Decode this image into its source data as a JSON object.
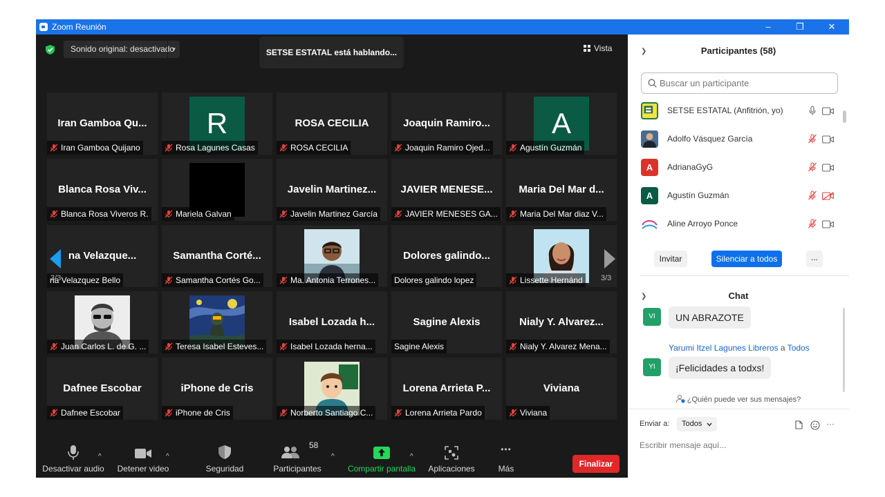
{
  "window": {
    "title": "Zoom Reunión",
    "minimize": "–",
    "restore": "❐",
    "close": "✕"
  },
  "top": {
    "sound_label": "Sonido original: desactivado",
    "sound_caret": "▼",
    "speaking": "SETSE ESTATAL está hablando...",
    "view_label": "Vista"
  },
  "pages": {
    "left": "3/3",
    "right": "3/3"
  },
  "tiles": [
    {
      "title": "Iran Gamboa Qu...",
      "label": "Iran Gamboa Quijano",
      "muted": true
    },
    {
      "initial": "R",
      "avatar_color": "#0b5a44",
      "label": "Rosa Lagunes Casas",
      "muted": true
    },
    {
      "title": "ROSA CECILIA",
      "label": "ROSA CECILIA",
      "muted": true
    },
    {
      "title": "Joaquin Ramiro...",
      "label": "Joaquin Ramiro Ojed...",
      "muted": true
    },
    {
      "initial": "A",
      "avatar_color": "#0b5a44",
      "label": "Agustín Guzmán",
      "muted": true
    },
    {
      "title": "Blanca Rosa Viv...",
      "label": "Blanca Rosa Viveros R.",
      "muted": true
    },
    {
      "photo": "black",
      "label": "Mariela Galvan",
      "muted": true
    },
    {
      "title": "Javelin Martinez...",
      "label": "Javelin Martinez García",
      "muted": true
    },
    {
      "title": "JAVIER MENESE...",
      "label": "JAVIER MENESES GA...",
      "muted": true
    },
    {
      "title": "Maria Del Mar d...",
      "label": "Maria Del Mar diaz V...",
      "muted": true
    },
    {
      "title": "na Velazque...",
      "label": "na Velazquez Bello",
      "muted": false
    },
    {
      "title": "Samantha Corté...",
      "label": "Samantha Cortés Go...",
      "muted": true
    },
    {
      "photo": "person-glasses",
      "label": "Ma. Antonia Terrones...",
      "muted": true
    },
    {
      "title": "Dolores galindo...",
      "label": "Dolores galindo lopez",
      "muted": false
    },
    {
      "photo": "woman",
      "label": "Lissette Hernánd",
      "muted": true
    },
    {
      "photo": "man-sunglasses",
      "label": "Juan Carlos L. de G. ...",
      "muted": true
    },
    {
      "photo": "starry-night",
      "label": "Teresa Isabel Esteves...",
      "muted": true
    },
    {
      "title": "Isabel Lozada h...",
      "label": "Isabel Lozada herna...",
      "muted": true
    },
    {
      "title": "Sagine Alexis",
      "label": "Sagine Alexis",
      "muted": false
    },
    {
      "title": "Nialy Y. Alvarez...",
      "label": "Nialy Y. Alvarez Mena...",
      "muted": true
    },
    {
      "title": "Dafnee Escobar",
      "label": "Dafnee Escobar",
      "muted": true
    },
    {
      "title": "iPhone de Cris",
      "label": "iPhone de Cris",
      "muted": true
    },
    {
      "photo": "cartoon",
      "label": "Norberto Santiago C...",
      "muted": true
    },
    {
      "title": "Lorena Arrieta P...",
      "label": "Lorena Arrieta Pardo",
      "muted": true
    },
    {
      "title": "Viviana",
      "label": "Viviana",
      "muted": true
    }
  ],
  "toolbar": {
    "audio": "Desactivar audio",
    "video": "Detener video",
    "security": "Seguridad",
    "participants": "Participantes",
    "participants_count": "58",
    "share": "Compartir pantalla",
    "apps": "Aplicaciones",
    "more": "Más",
    "end": "Finalizar",
    "caret": "^",
    "more_dots": "•••"
  },
  "participants_panel": {
    "title": "Participantes (58)",
    "search_placeholder": "Buscar un participante",
    "items": [
      {
        "name": "SETSE ESTATAL (Anfitrión, yo)",
        "avatar": "logo",
        "mic": "on",
        "cam": "on"
      },
      {
        "name": "Adolfo Vásquez García",
        "avatar": "photo",
        "mic": "off",
        "cam": "on"
      },
      {
        "name": "AdrianaGyG",
        "avatar": "A",
        "avatar_color": "#d9342b",
        "mic": "off",
        "cam": "on"
      },
      {
        "name": "Agustín Guzmán",
        "avatar": "A",
        "avatar_color": "#0b5a44",
        "mic": "off",
        "cam": "off"
      },
      {
        "name": "Aline Arroyo Ponce",
        "avatar": "logo2",
        "mic": "off",
        "cam": "on"
      }
    ],
    "invite": "Invitar",
    "mute_all": "Silenciar a todos",
    "more": "..."
  },
  "chat": {
    "title": "Chat",
    "messages": [
      {
        "initials": "VI",
        "text": "UN ABRAZOTE"
      },
      {
        "initials": "YI",
        "sender": "Yarumi Itzel Lagunes Libreros",
        "to_word": "a",
        "to": "Todos",
        "text": "¡Felicidades a todxs!"
      }
    ],
    "who_sees": "¿Quién puede ver sus mensajes?",
    "send_to_label": "Enviar a:",
    "send_to_value": "Todos",
    "input_placeholder": "Escribir mensaje aquí...",
    "more": "···"
  },
  "colors": {
    "title_bar": "#1a73e8",
    "accent_blue": "#0e71eb",
    "share_green": "#23d959",
    "end_red": "#e02828",
    "muted_red": "#e0443e"
  }
}
